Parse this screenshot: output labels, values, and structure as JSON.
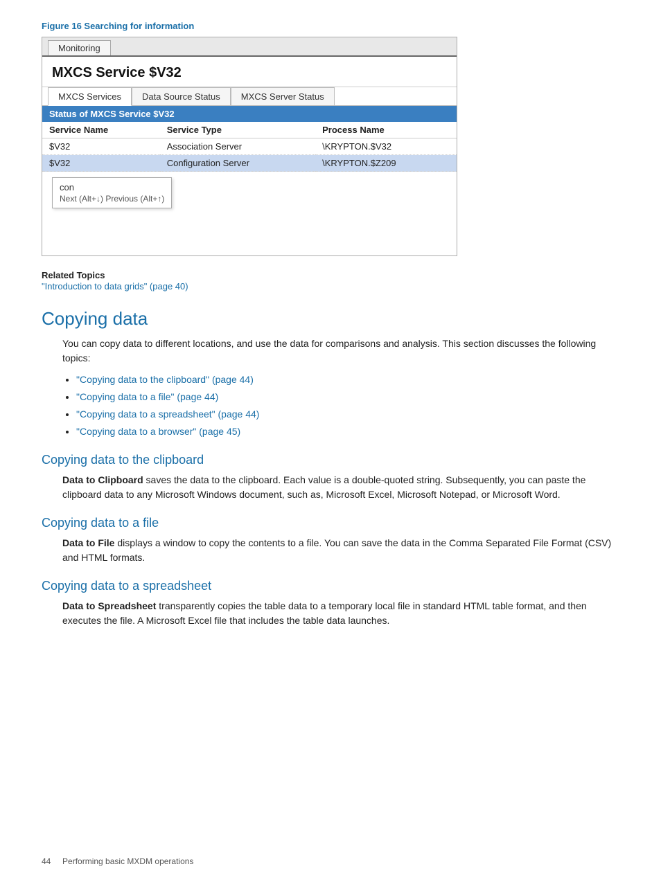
{
  "figure": {
    "caption": "Figure 16 Searching for information",
    "screenshot": {
      "tab": "Monitoring",
      "window_title": "MXCS Service $V32",
      "inner_tabs": [
        "MXCS Services",
        "Data Source Status",
        "MXCS Server Status"
      ],
      "status_header": "Status of MXCS Service $V32",
      "table": {
        "headers": [
          "Service Name",
          "Service Type",
          "Process Name"
        ],
        "rows": [
          {
            "service_name": "$V32",
            "service_type": "Association Server",
            "process_name": "\\KRYPTON.$V32",
            "selected": false
          },
          {
            "service_name": "$V32",
            "service_type": "Configuration Server",
            "process_name": "\\KRYPTON.$Z209",
            "selected": true
          }
        ]
      },
      "search_input": "con",
      "search_nav": "Next (Alt+↓) Previous (Alt+↑)"
    }
  },
  "related_topics": {
    "title": "Related Topics",
    "link_text": "\"Introduction to data grids\" (page 40)"
  },
  "sections": {
    "copying_data": {
      "heading": "Copying data",
      "intro": "You can copy data to different locations, and use the data for comparisons and analysis. This section discusses the following topics:",
      "bullets": [
        "\"Copying data to the clipboard\" (page 44)",
        "\"Copying data to a file\" (page 44)",
        "\"Copying data to a spreadsheet\" (page 44)",
        "\"Copying data to a browser\" (page 45)"
      ]
    },
    "clipboard": {
      "heading": "Copying data to the clipboard",
      "term": "Data to Clipboard",
      "body": " saves the data to the clipboard. Each value is a double-quoted string. Subsequently, you can paste the clipboard data to any Microsoft Windows document, such as, Microsoft Excel, Microsoft Notepad, or Microsoft Word."
    },
    "file": {
      "heading": "Copying data to a file",
      "term": "Data to File",
      "body": " displays a window to copy the contents to a file. You can save the data in the Comma Separated File Format (CSV) and HTML formats."
    },
    "spreadsheet": {
      "heading": "Copying data to a spreadsheet",
      "term": "Data to Spreadsheet",
      "body": " transparently copies the table data to a temporary local file in standard HTML table format, and then executes the file. A Microsoft Excel file that includes the table data launches."
    }
  },
  "footer": {
    "page_number": "44",
    "text": "Performing basic MXDM operations"
  }
}
